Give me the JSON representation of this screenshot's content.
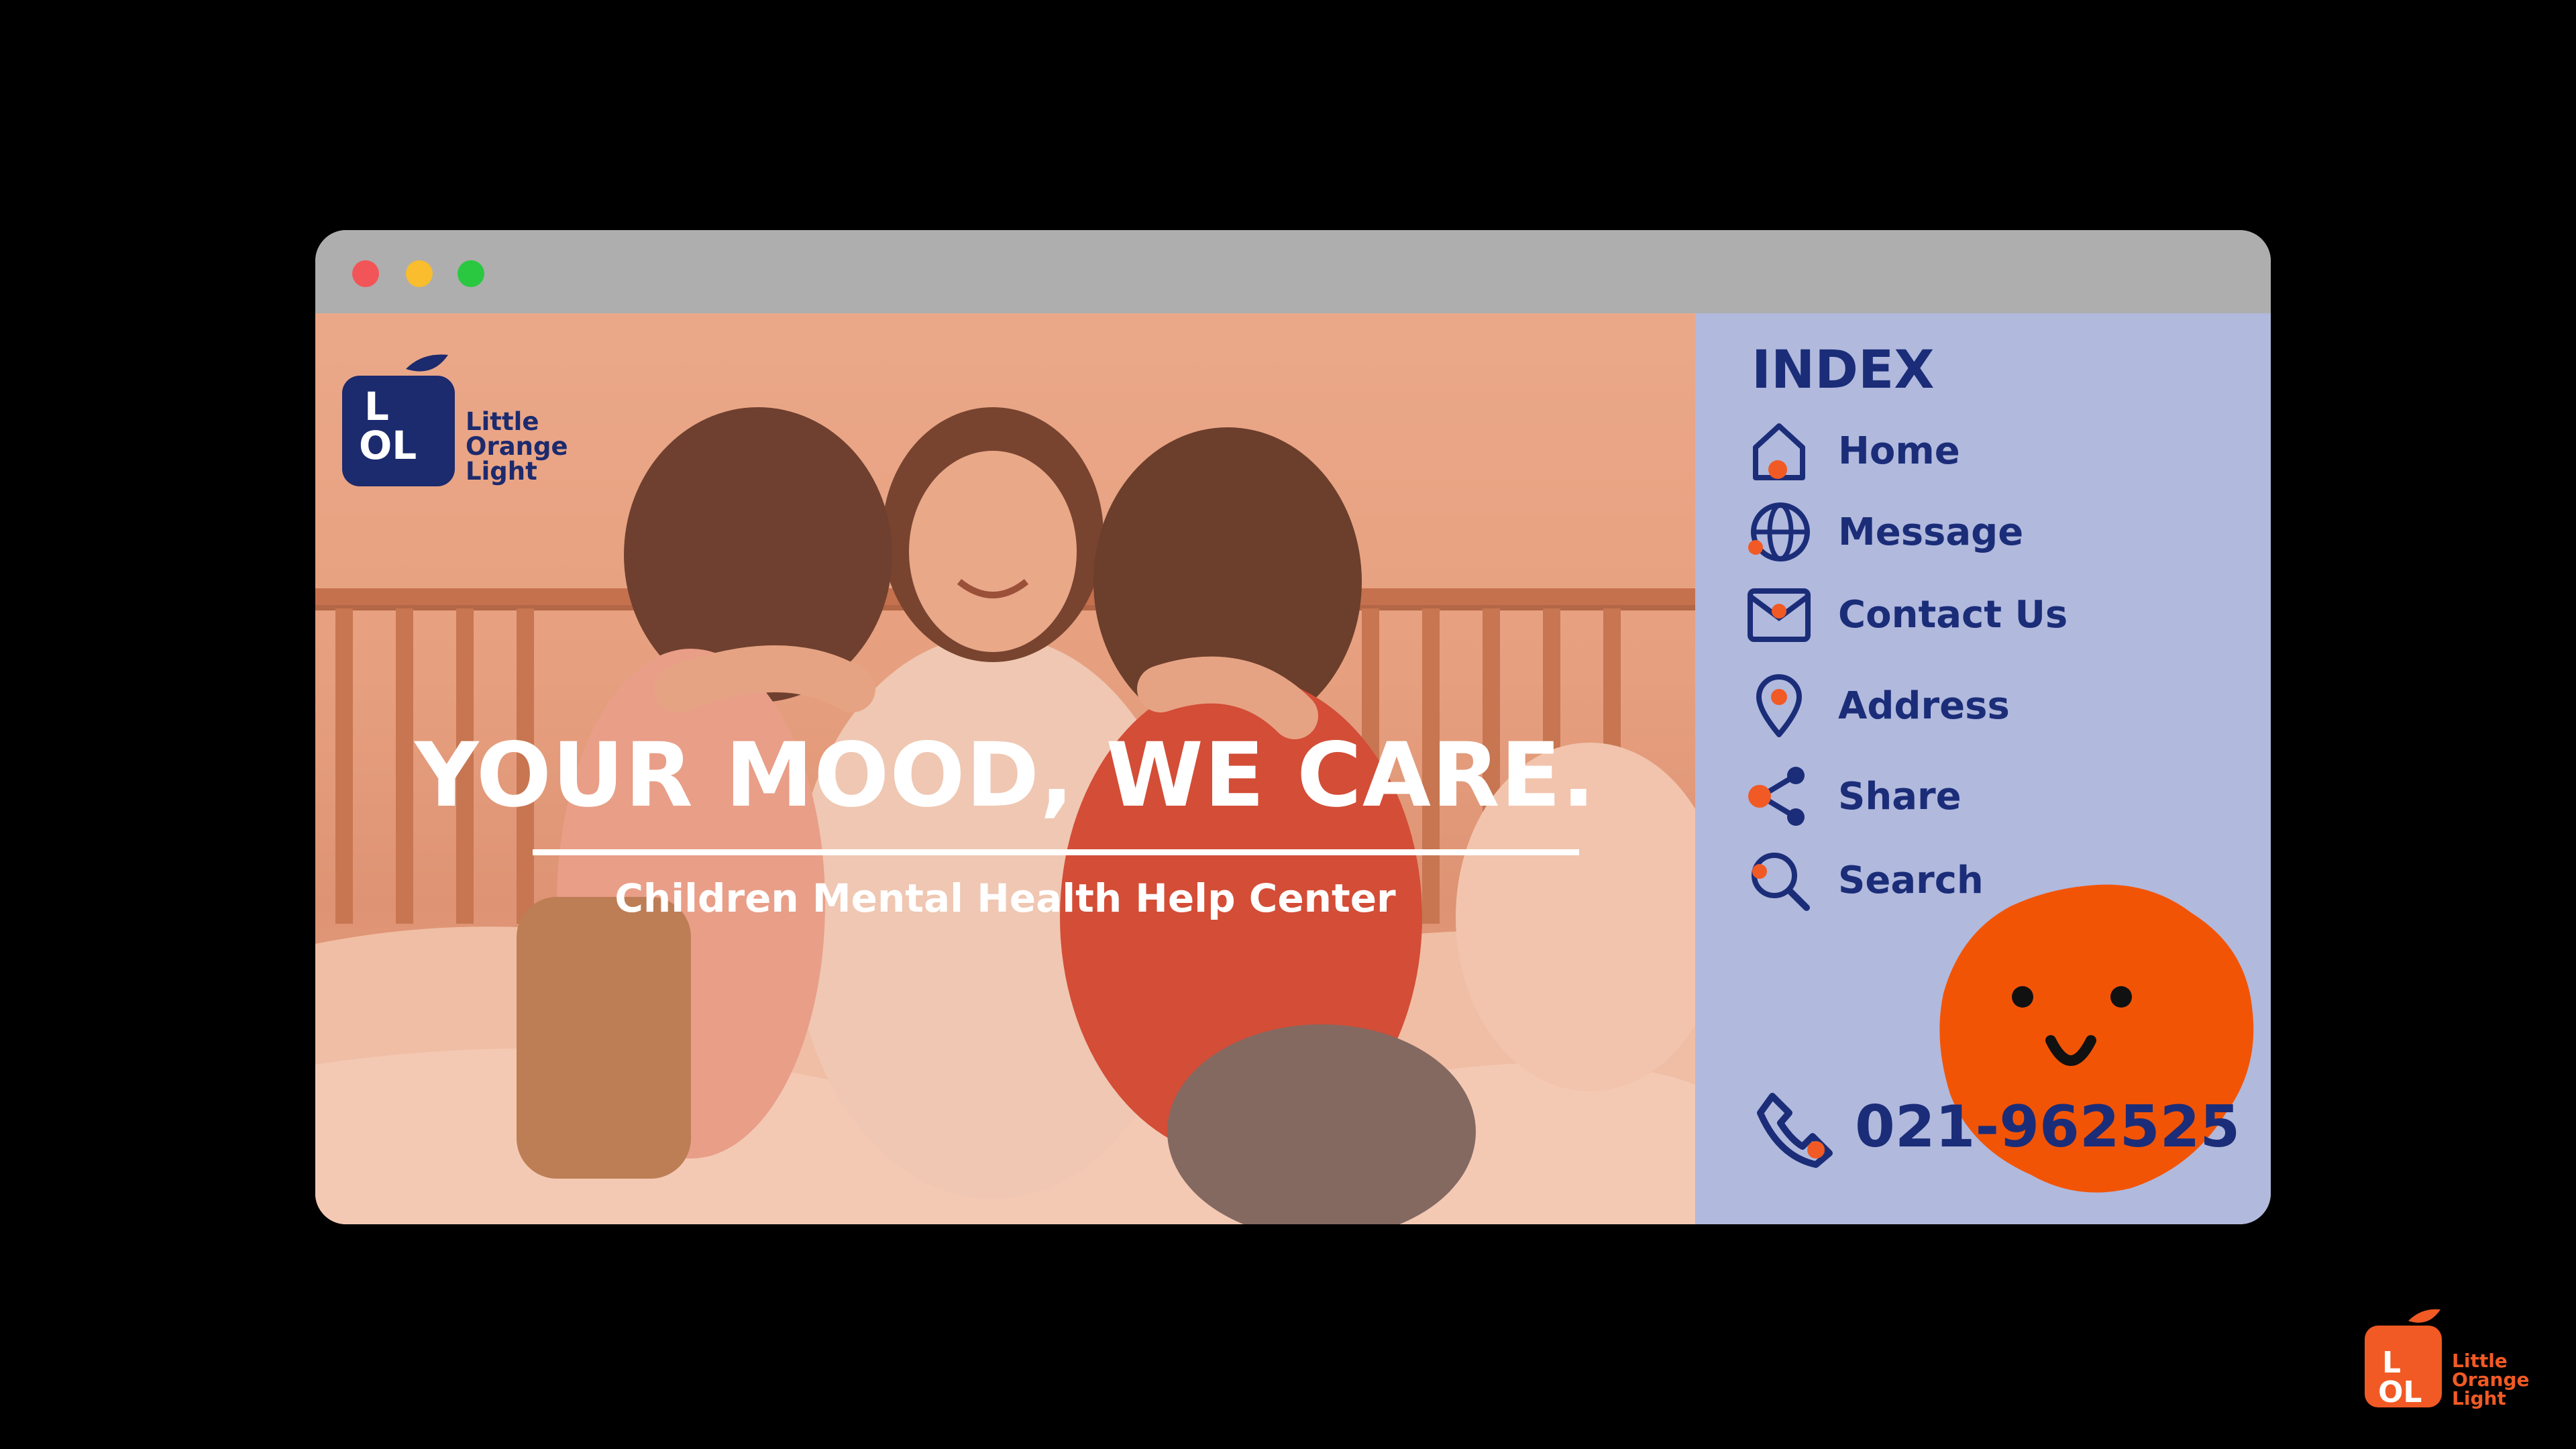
{
  "window": {
    "controls": {
      "close_color": "#f25557",
      "minimize_color": "#f9bd2d",
      "maximize_color": "#2ac840"
    }
  },
  "brand": {
    "mark_letters": [
      "L",
      "OL"
    ],
    "name_lines": [
      "Little",
      "Orange",
      "Light"
    ],
    "primary_color": "#1c2a6e",
    "accent_color": "#f15a24"
  },
  "hero": {
    "headline": "YOUR MOOD, WE CARE.",
    "subheadline": "Children Mental Health Help Center",
    "image_description": "Mother hugging two children on a bed"
  },
  "sidebar": {
    "title": "INDEX",
    "items": [
      {
        "label": "Home",
        "icon": "home-icon"
      },
      {
        "label": "Message",
        "icon": "globe-icon"
      },
      {
        "label": "Contact Us",
        "icon": "mail-icon"
      },
      {
        "label": "Address",
        "icon": "map-pin-icon"
      },
      {
        "label": "Share",
        "icon": "share-icon"
      },
      {
        "label": "Search",
        "icon": "search-icon"
      }
    ],
    "phone": "021-962525",
    "background_color": "#b1b9dd",
    "text_color": "#1b2d78"
  },
  "corner_brand": {
    "mark_letters": [
      "L",
      "OL"
    ],
    "name_lines": [
      "Little",
      "Orange",
      "Light"
    ]
  }
}
